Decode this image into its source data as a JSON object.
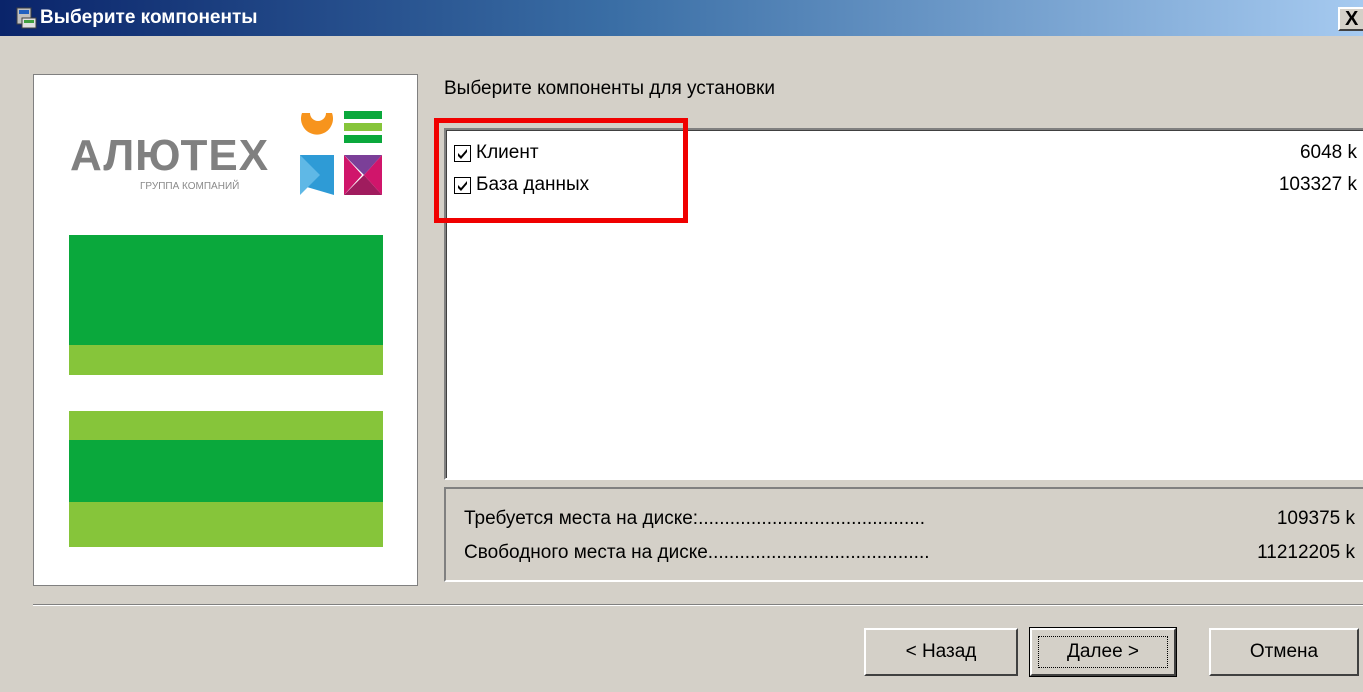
{
  "window": {
    "title": "Выберите компоненты",
    "icon": "installer-icon",
    "close_label": "X"
  },
  "logo": {
    "name": "АЛЮТЕХ",
    "subtitle": "ГРУППА КОМПАНИЙ",
    "colors": {
      "green_dark": "#0aa83c",
      "green_light": "#86c53a",
      "orange": "#f7941d",
      "blue": "#2e9bd6",
      "purple": "#7b3f98",
      "magenta": "#d0156b"
    }
  },
  "main": {
    "heading": "Выберите компоненты для установки",
    "components": [
      {
        "label": "Клиент",
        "size": "6048 k",
        "checked": true
      },
      {
        "label": "База данных",
        "size": "103327 k",
        "checked": true
      }
    ],
    "disk": {
      "required_label": "Требуется места на диске:...........................................",
      "required_value": "109375 k",
      "free_label": "Свободного места на диске..........................................",
      "free_value": "11212205 k"
    }
  },
  "buttons": {
    "back": "< Назад",
    "next": "Далее >",
    "cancel": "Отмена"
  },
  "annotation": {
    "highlight_color": "#f00000"
  }
}
